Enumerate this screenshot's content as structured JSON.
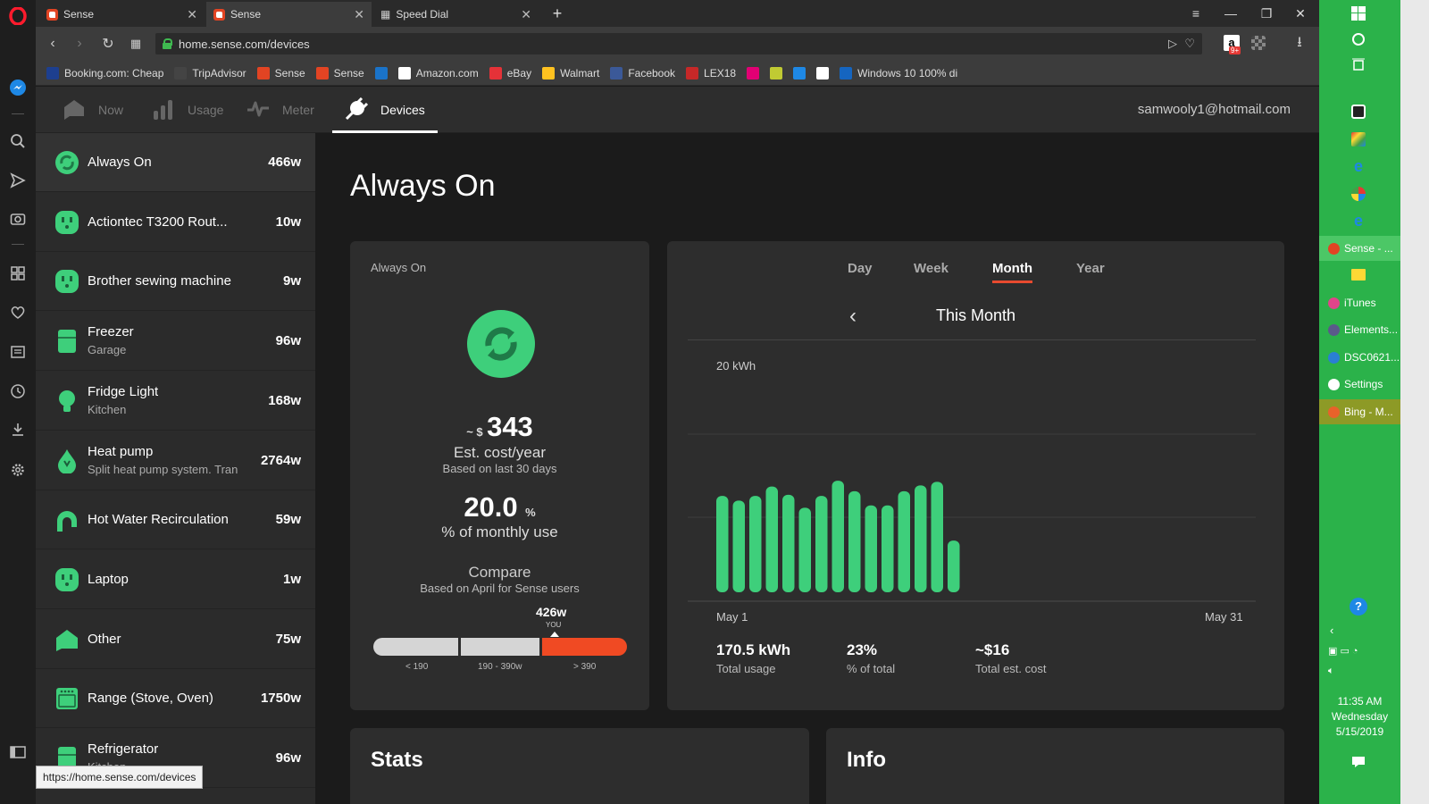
{
  "browser": {
    "tabs": [
      {
        "title": "Sense",
        "active": false
      },
      {
        "title": "Sense",
        "active": true
      },
      {
        "title": "Speed Dial",
        "active": false
      }
    ],
    "url": "home.sense.com/devices",
    "status_url": "https://home.sense.com/devices",
    "bookmarks": [
      {
        "label": "Booking.com: Cheap",
        "color": "#1d3f8f"
      },
      {
        "label": "TripAdvisor",
        "color": "#444444"
      },
      {
        "label": "Sense",
        "color": "#e24423"
      },
      {
        "label": "Sense",
        "color": "#e24423"
      },
      {
        "label": "",
        "color": "#1a73c9"
      },
      {
        "label": "Amazon.com",
        "color": "#ffffff"
      },
      {
        "label": "eBay",
        "color": "#e53238"
      },
      {
        "label": "Walmart",
        "color": "#ffc220"
      },
      {
        "label": "Facebook",
        "color": "#3b5998"
      },
      {
        "label": "LEX18",
        "color": "#c62828"
      },
      {
        "label": "",
        "color": "#e20074"
      },
      {
        "label": "",
        "color": "#c0ca33"
      },
      {
        "label": "",
        "color": "#1e88e5"
      },
      {
        "label": "",
        "color": "#ffffff"
      },
      {
        "label": "Windows 10 100% di",
        "color": "#1565c0"
      }
    ],
    "amazon_badge": "9+"
  },
  "nav": {
    "items": [
      {
        "label": "Now",
        "icon": "home-icon",
        "active": false
      },
      {
        "label": "Usage",
        "icon": "bar-chart-icon",
        "active": false
      },
      {
        "label": "Meter",
        "icon": "pulse-icon",
        "active": false
      },
      {
        "label": "Devices",
        "icon": "plug-icon",
        "active": true
      }
    ],
    "user_email": "samwooly1@hotmail.com"
  },
  "devices": [
    {
      "name": "Always On",
      "sub": "",
      "watts": "466w",
      "icon": "always-on-icon",
      "active": true
    },
    {
      "name": "Actiontec T3200 Rout...",
      "sub": "",
      "watts": "10w",
      "icon": "outlet-icon"
    },
    {
      "name": "Brother sewing machine",
      "sub": "",
      "watts": "9w",
      "icon": "outlet-icon"
    },
    {
      "name": "Freezer",
      "sub": "Garage",
      "watts": "96w",
      "icon": "fridge-icon"
    },
    {
      "name": "Fridge Light",
      "sub": "Kitchen",
      "watts": "168w",
      "icon": "bulb-icon"
    },
    {
      "name": "Heat pump",
      "sub": "Split heat pump system. Tran",
      "watts": "2764w",
      "icon": "drop-icon"
    },
    {
      "name": "Hot Water Recirculation",
      "sub": "",
      "watts": "59w",
      "icon": "faucet-icon"
    },
    {
      "name": "Laptop",
      "sub": "",
      "watts": "1w",
      "icon": "outlet-icon"
    },
    {
      "name": "Other",
      "sub": "",
      "watts": "75w",
      "icon": "house-icon"
    },
    {
      "name": "Range (Stove, Oven)",
      "sub": "",
      "watts": "1750w",
      "icon": "stove-icon"
    },
    {
      "name": "Refrigerator",
      "sub": "Kitchen",
      "watts": "96w",
      "icon": "fridge-icon"
    }
  ],
  "main": {
    "title": "Always On",
    "summary": {
      "label": "Always On",
      "cost_prefix": "~ $",
      "cost": "343",
      "cost_caption": "Est. cost/year",
      "cost_sub": "Based on last 30 days",
      "percent": "20.0",
      "percent_unit": "%",
      "percent_caption": "% of monthly use",
      "compare_title": "Compare",
      "compare_sub": "Based on April for Sense users",
      "you_value": "426w",
      "you_label": "YOU",
      "ranges": [
        "< 190",
        "190 - 390w",
        "> 390"
      ]
    },
    "usage": {
      "periods": [
        {
          "label": "Day",
          "active": false
        },
        {
          "label": "Week",
          "active": false
        },
        {
          "label": "Month",
          "active": true
        },
        {
          "label": "Year",
          "active": false
        }
      ],
      "back_label": "‹",
      "current_period": "This Month",
      "stats": [
        {
          "value": "170.5 kWh",
          "label": "Total usage"
        },
        {
          "value": "23%",
          "label": "% of total"
        },
        {
          "value": "~$16",
          "label": "Total est. cost"
        }
      ]
    },
    "stats_title": "Stats",
    "info_title": "Info"
  },
  "chart_data": {
    "type": "bar",
    "ylabel": "20 kWh",
    "x_start_label": "May 1",
    "x_end_label": "May 31",
    "ylim": [
      0,
      20
    ],
    "color": "#3ecf7b",
    "categories": [
      "May 1",
      "May 2",
      "May 3",
      "May 4",
      "May 5",
      "May 6",
      "May 7",
      "May 8",
      "May 9",
      "May 10",
      "May 11",
      "May 12",
      "May 13",
      "May 14",
      "May 15"
    ],
    "values": [
      8.2,
      7.8,
      8.2,
      9.0,
      8.3,
      7.2,
      8.2,
      9.5,
      8.6,
      7.4,
      7.4,
      8.6,
      9.1,
      9.4,
      4.4
    ]
  },
  "taskbar": {
    "apps": [
      {
        "label": "Sense - ...",
        "color": "#e24423",
        "highlight": "hl"
      },
      {
        "label": "iTunes",
        "color": "#e0448a",
        "highlight": ""
      },
      {
        "label": "Elements...",
        "color": "#5a5a8a",
        "highlight": ""
      },
      {
        "label": "DSC0621...",
        "color": "#2a7fd4",
        "highlight": ""
      },
      {
        "label": "Settings",
        "color": "#ffffff",
        "highlight": ""
      },
      {
        "label": "Bing - M...",
        "color": "#e8622a",
        "highlight": "hl2"
      }
    ],
    "time": "11:35 AM",
    "day": "Wednesday",
    "date": "5/15/2019"
  }
}
